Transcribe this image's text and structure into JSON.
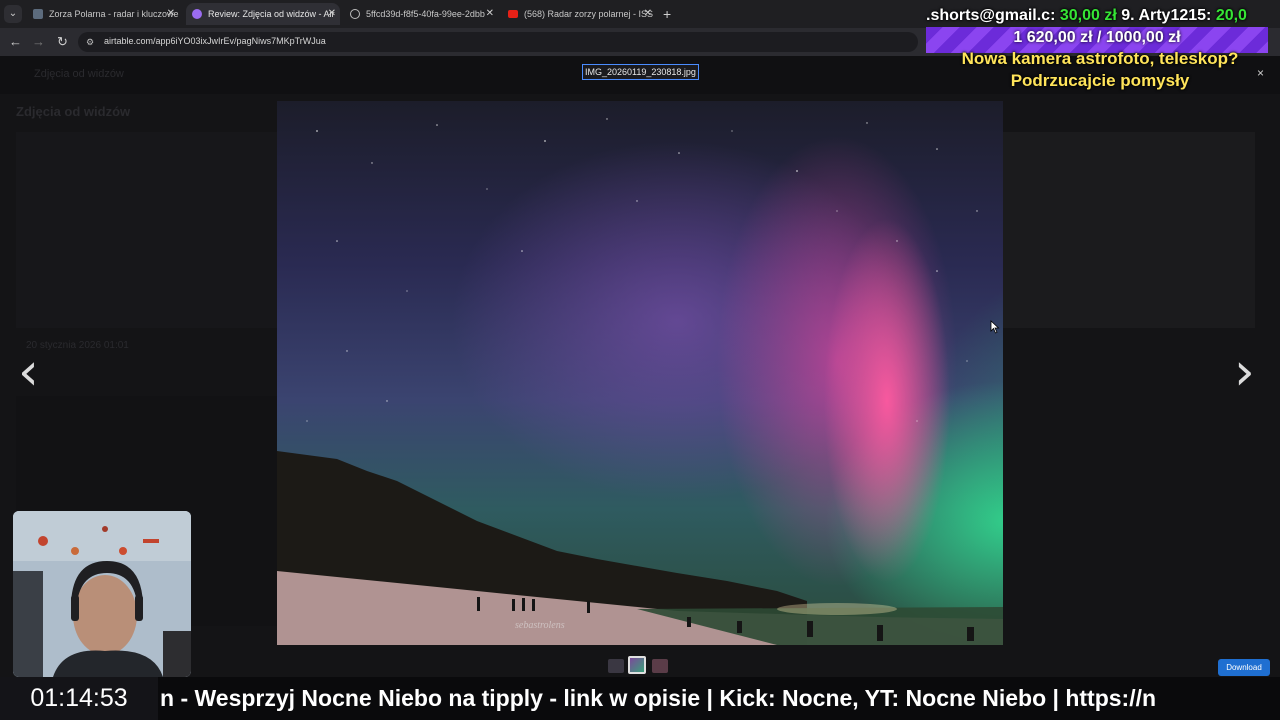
{
  "browser": {
    "tabs": [
      {
        "title": "Zorza Polarna - radar i kluczowe"
      },
      {
        "title": "Review: Zdjęcia od widzów - Air"
      },
      {
        "title": "5ffcd39d-f8f5-40fa-99ee-2dbb"
      },
      {
        "title": "(568) Radar zorzy polarnej - ISS"
      }
    ],
    "url": "airtable.com/app6iYO03ixJwIrEv/pagNiws7MKpTrWJua"
  },
  "page": {
    "section_title": "Zdjęcia od widzów",
    "card_date": "20 stycznia 2026 01:01",
    "breadcrumb": "Zdjęcia od widzów"
  },
  "viewer": {
    "filename": "IMG_20260119_230818.jpg",
    "watermark": "sebastrolens",
    "download_label": "Download",
    "close_symbol": "×",
    "prev_symbol": "‹",
    "next_symbol": "›"
  },
  "stream": {
    "donation_line": {
      "prefix": ".shorts@gmail.c: ",
      "amount1": "30,00 zł",
      "middle": " 9. Arty1215: ",
      "amount2": "20,0"
    },
    "goal_progress": "1 620,00 zł / 1000,00 zł",
    "goal_fraction": 1.62,
    "goal_title_line1": "Nowa kamera astrofoto, teleskop?",
    "goal_title_line2": "Podrzucajcie pomysły",
    "clock": "01:14:53",
    "ticker": "n - Wesprzyj Nocne Niebo na tipply - link w opisie  |  Kick: Nocne, YT: Nocne Niebo  |  https://n"
  },
  "colors": {
    "accent": "#4a8cff",
    "download": "#1f6fd1",
    "donation_amount": "#36e536",
    "goal_text": "#ffe45a",
    "goal_bar": "#7b3be6"
  }
}
